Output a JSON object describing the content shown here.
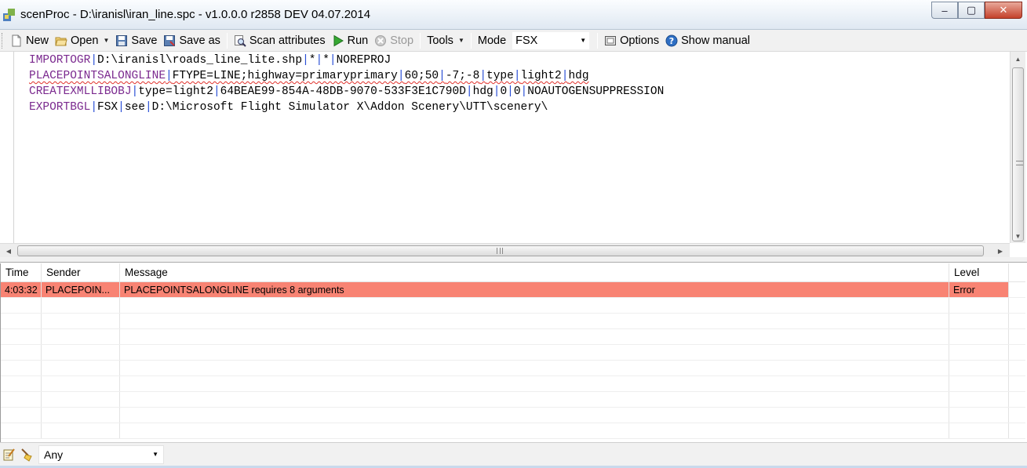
{
  "window": {
    "title": "scenProc - D:\\iranisl\\iran_line.spc - v1.0.0.0 r2858 DEV 04.07.2014",
    "minimize_glyph": "‒",
    "maximize_glyph": "▢",
    "close_glyph": "✕"
  },
  "toolbar": {
    "new_label": "New",
    "open_label": "Open",
    "save_label": "Save",
    "saveas_label": "Save as",
    "scan_label": "Scan attributes",
    "run_label": "Run",
    "stop_label": "Stop",
    "tools_label": "Tools",
    "mode_label": "Mode",
    "mode_value": "FSX",
    "options_label": "Options",
    "manual_label": "Show manual"
  },
  "editor": {
    "lines": [
      [
        {
          "t": "IMPORTOGR",
          "c": "kw"
        },
        {
          "t": "|",
          "c": "sep"
        },
        {
          "t": "D:\\iranisl\\roads_line_lite.shp",
          "c": "txt"
        },
        {
          "t": "|",
          "c": "sep"
        },
        {
          "t": "*",
          "c": "txt"
        },
        {
          "t": "|",
          "c": "sep"
        },
        {
          "t": "*",
          "c": "txt"
        },
        {
          "t": "|",
          "c": "sep"
        },
        {
          "t": "NOREPROJ",
          "c": "txt"
        }
      ],
      [
        {
          "t": "PLACEPOINTSALONGLINE",
          "c": "kw",
          "err": true
        },
        {
          "t": "|",
          "c": "sep",
          "err": true
        },
        {
          "t": "FTYPE=LINE;highway=primaryprimary",
          "c": "txt",
          "err": true
        },
        {
          "t": "|",
          "c": "sep",
          "err": true
        },
        {
          "t": "60;50",
          "c": "txt",
          "err": true
        },
        {
          "t": "|",
          "c": "sep",
          "err": true
        },
        {
          "t": "-7;-8",
          "c": "txt",
          "err": true
        },
        {
          "t": "|",
          "c": "sep",
          "err": true
        },
        {
          "t": "type",
          "c": "txt",
          "err": true
        },
        {
          "t": "|",
          "c": "sep",
          "err": true
        },
        {
          "t": "light2",
          "c": "txt",
          "err": true
        },
        {
          "t": "|",
          "c": "sep",
          "err": true
        },
        {
          "t": "hdg",
          "c": "txt",
          "err": true
        }
      ],
      [
        {
          "t": "CREATEXMLLIBOBJ",
          "c": "kw"
        },
        {
          "t": "|",
          "c": "sep"
        },
        {
          "t": "type=light2",
          "c": "txt"
        },
        {
          "t": "|",
          "c": "sep"
        },
        {
          "t": "64BEAE99-854A-48DB-9070-533F3E1C790D",
          "c": "txt"
        },
        {
          "t": "|",
          "c": "sep"
        },
        {
          "t": "hdg",
          "c": "txt"
        },
        {
          "t": "|",
          "c": "sep"
        },
        {
          "t": "0",
          "c": "txt"
        },
        {
          "t": "|",
          "c": "sep"
        },
        {
          "t": "0",
          "c": "txt"
        },
        {
          "t": "|",
          "c": "sep"
        },
        {
          "t": "NOAUTOGENSUPPRESSION",
          "c": "txt"
        }
      ],
      [
        {
          "t": "EXPORTBGL",
          "c": "kw"
        },
        {
          "t": "|",
          "c": "sep"
        },
        {
          "t": "FSX",
          "c": "txt"
        },
        {
          "t": "|",
          "c": "sep"
        },
        {
          "t": "see",
          "c": "txt"
        },
        {
          "t": "|",
          "c": "sep"
        },
        {
          "t": "D:\\Microsoft Flight Simulator X\\Addon Scenery\\UTT\\scenery\\",
          "c": "txt"
        }
      ]
    ]
  },
  "log": {
    "columns": {
      "time": "Time",
      "sender": "Sender",
      "message": "Message",
      "level": "Level"
    },
    "rows": [
      {
        "time": "4:03:32",
        "sender": "PLACEPOIN...",
        "message": "PLACEPOINTSALONGLINE requires 8 arguments",
        "level": "Error"
      }
    ]
  },
  "filter": {
    "value": "Any"
  },
  "colors": {
    "error_row": "#f88373",
    "keyword": "#7b2a8f",
    "separator": "#2a4fd6"
  }
}
